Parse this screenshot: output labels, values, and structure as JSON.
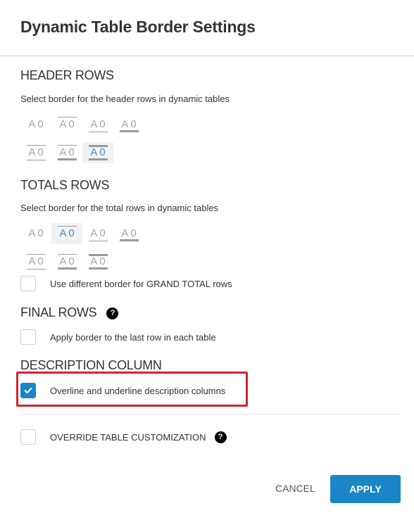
{
  "dialog": {
    "title": "Dynamic Table Border Settings"
  },
  "header_rows": {
    "heading": "HEADER ROWS",
    "description": "Select border for the header rows in dynamic tables",
    "options": [
      {
        "label": "A0",
        "overline": "none",
        "underline": "none",
        "selected": false
      },
      {
        "label": "A0",
        "overline": "thin",
        "underline": "none",
        "selected": false
      },
      {
        "label": "A0",
        "overline": "none",
        "underline": "thin",
        "selected": false
      },
      {
        "label": "A0",
        "overline": "none",
        "underline": "thick",
        "selected": false
      },
      {
        "label": "A0",
        "overline": "thin",
        "underline": "thin",
        "selected": false
      },
      {
        "label": "A0",
        "overline": "thin",
        "underline": "thick",
        "selected": false
      },
      {
        "label": "A0",
        "overline": "thick",
        "underline": "thick",
        "selected": true
      }
    ]
  },
  "totals_rows": {
    "heading": "TOTALS ROWS",
    "description": "Select border for the total rows in dynamic tables",
    "options": [
      {
        "label": "A0",
        "overline": "none",
        "underline": "none",
        "selected": false
      },
      {
        "label": "A0",
        "overline": "thin",
        "underline": "none",
        "selected": true
      },
      {
        "label": "A0",
        "overline": "none",
        "underline": "thin",
        "selected": false
      },
      {
        "label": "A0",
        "overline": "none",
        "underline": "thick",
        "selected": false
      },
      {
        "label": "A0",
        "overline": "thin",
        "underline": "thin",
        "selected": false
      },
      {
        "label": "A0",
        "overline": "thin",
        "underline": "thick",
        "selected": false
      },
      {
        "label": "A0",
        "overline": "thick",
        "underline": "thick",
        "selected": false
      }
    ],
    "grand_total_checkbox": {
      "label": "Use different border for GRAND TOTAL rows",
      "checked": false
    }
  },
  "final_rows": {
    "heading": "FINAL ROWS",
    "help_icon": "question-circle-icon",
    "checkbox": {
      "label": "Apply border to the last row in each table",
      "checked": false
    }
  },
  "description_column": {
    "heading": "DESCRIPTION COLUMN",
    "checkbox": {
      "label": "Overline and underline description columns",
      "checked": true
    }
  },
  "override": {
    "checkbox": {
      "label": "OVERRIDE TABLE CUSTOMIZATION",
      "checked": false
    },
    "help_icon": "question-circle-icon"
  },
  "footer": {
    "cancel_label": "CANCEL",
    "apply_label": "APPLY"
  },
  "colors": {
    "accent": "#1a86c8",
    "selected_text": "#3f8fcb",
    "highlight_border": "#d2232f"
  }
}
